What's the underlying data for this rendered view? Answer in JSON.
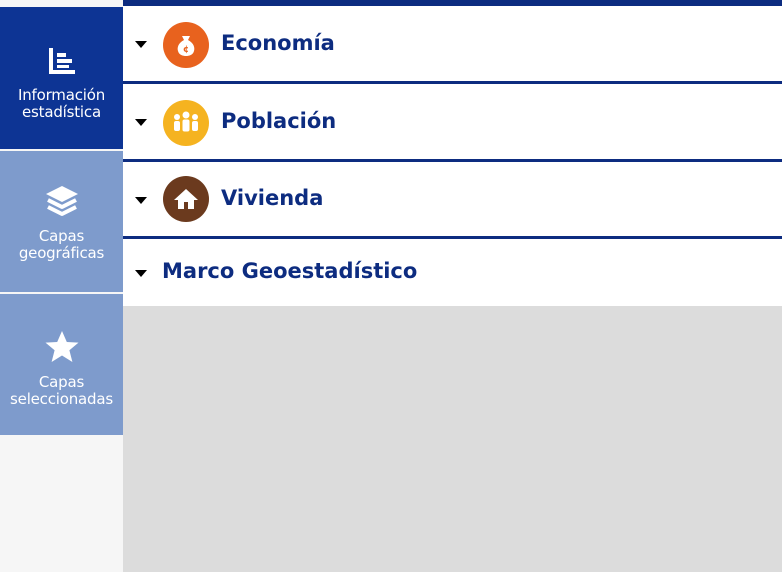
{
  "sidebar": {
    "items": [
      {
        "label_line1": "Información",
        "label_line2": "estadística",
        "icon": "bar-list-icon",
        "state": "active"
      },
      {
        "label_line1": "Capas",
        "label_line2": "geográficas",
        "icon": "layers-icon",
        "state": "inactive"
      },
      {
        "label_line1": "Capas",
        "label_line2": "seleccionadas",
        "icon": "star-icon",
        "state": "inactive"
      }
    ]
  },
  "categories": [
    {
      "label": "Economía",
      "icon": "money-bag-icon",
      "color": "#e8621e"
    },
    {
      "label": "Población",
      "icon": "people-icon",
      "color": "#f5b320"
    },
    {
      "label": "Vivienda",
      "icon": "house-icon",
      "color": "#6b3a1e"
    },
    {
      "label": "Marco Geoestadístico",
      "icon": "none"
    }
  ],
  "colors": {
    "active": "#0d3494",
    "inactive": "#7e9bcc",
    "label": "#0d2c80",
    "panel": "#dcdcdc"
  }
}
